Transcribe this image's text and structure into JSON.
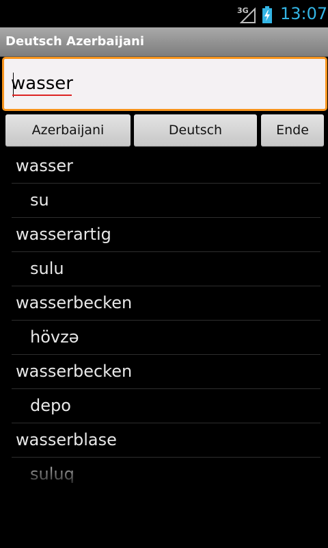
{
  "status": {
    "network": "3G",
    "time": "13:07",
    "accent": "#33b5e5"
  },
  "app": {
    "title": "Deutsch Azerbaijani"
  },
  "search": {
    "value": "wasser",
    "accent": "#f7941d"
  },
  "buttons": {
    "azerbaijani": "Azerbaijani",
    "deutsch": "Deutsch",
    "ende": "Ende"
  },
  "results": [
    {
      "word": "wasser",
      "translation": "su"
    },
    {
      "word": "wasserartig",
      "translation": "sulu"
    },
    {
      "word": "wasserbecken",
      "translation": "hövzə"
    },
    {
      "word": "wasserbecken",
      "translation": "depo"
    },
    {
      "word": "wasserblase",
      "translation": "suluq"
    }
  ]
}
